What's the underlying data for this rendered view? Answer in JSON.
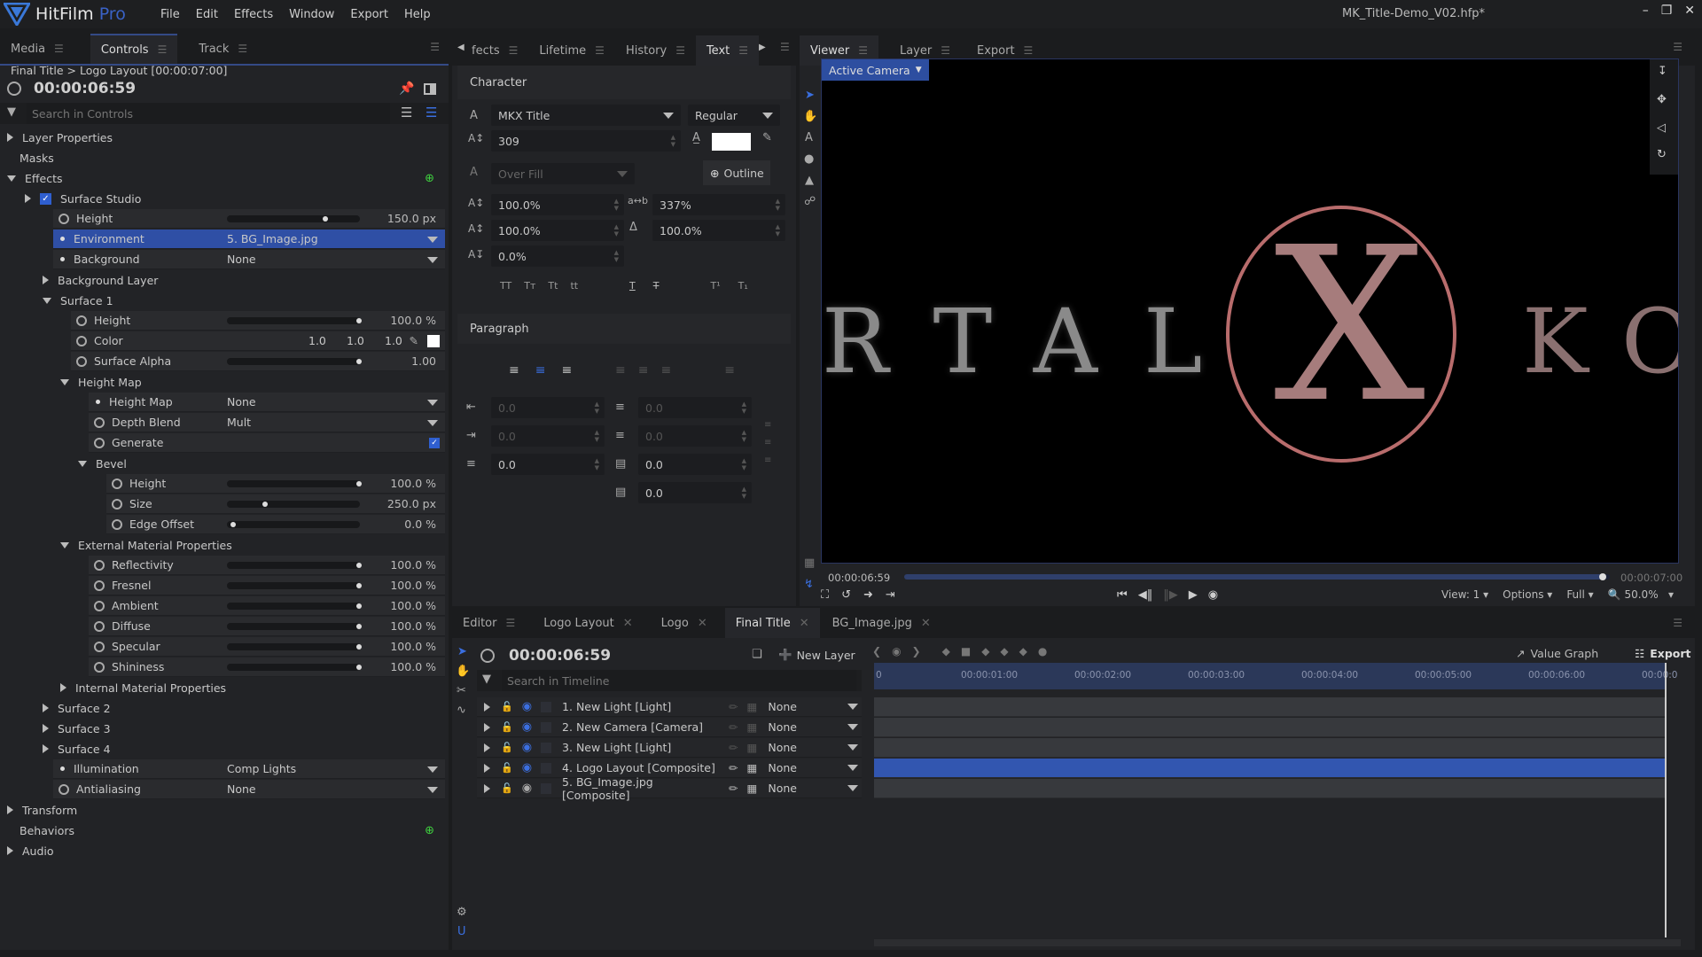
{
  "app": {
    "name": "HitFilm",
    "edition": "Pro",
    "window_title": "MK_Title-Demo_V02.hfp*"
  },
  "menu": [
    "File",
    "Edit",
    "Effects",
    "Window",
    "Export",
    "Help"
  ],
  "left_panel": {
    "tabs": [
      {
        "label": "Media"
      },
      {
        "label": "Controls",
        "active": true
      },
      {
        "label": "Track"
      }
    ],
    "breadcrumb": "Final Title > Logo Layout [00:00:07:00]",
    "timecode": "00:00:06:59",
    "search_placeholder": "Search in Controls",
    "tree": [
      {
        "label": "Layer Properties",
        "type": "group",
        "expanded": false
      },
      {
        "label": "Masks",
        "type": "group-noarrow"
      },
      {
        "label": "Effects",
        "type": "group",
        "expanded": true
      },
      {
        "label": "Surface Studio",
        "type": "effect",
        "checked": true
      },
      {
        "label": "Height",
        "type": "slider",
        "value": "150.0 px",
        "fraction": 0.73
      },
      {
        "label": "Environment",
        "type": "dropdown",
        "value": "5. BG_Image.jpg",
        "selected": true
      },
      {
        "label": "Background",
        "type": "dropdown",
        "value": "None"
      },
      {
        "label": "Background Layer",
        "type": "subgroup",
        "expanded": false
      },
      {
        "label": "Surface 1",
        "type": "subgroup",
        "expanded": true
      },
      {
        "label": "Height",
        "type": "slider",
        "value": "100.0 %",
        "fraction": 1.0
      },
      {
        "label": "Color",
        "type": "color",
        "r": "1.0",
        "g": "1.0",
        "b": "1.0",
        "swatch": "#ffffff"
      },
      {
        "label": "Surface Alpha",
        "type": "slider",
        "value": "1.00",
        "fraction": 1.0
      },
      {
        "label": "Height Map",
        "type": "subgroup2",
        "expanded": true
      },
      {
        "label": "Height Map",
        "type": "dropdown",
        "value": "None"
      },
      {
        "label": "Depth Blend",
        "type": "dropdown",
        "value": "Mult"
      },
      {
        "label": "Generate",
        "type": "checkbox",
        "checked": true
      },
      {
        "label": "Bevel",
        "type": "subgroup3",
        "expanded": true
      },
      {
        "label": "Height",
        "type": "slider",
        "value": "100.0 %",
        "fraction": 1.0
      },
      {
        "label": "Size",
        "type": "slider",
        "value": "250.0 px",
        "fraction": 0.25
      },
      {
        "label": "Edge Offset",
        "type": "slider",
        "value": "0.0 %",
        "fraction": 0.0
      },
      {
        "label": "External Material Properties",
        "type": "subgroup2",
        "expanded": true
      },
      {
        "label": "Reflectivity",
        "type": "slider",
        "value": "100.0 %",
        "fraction": 1.0
      },
      {
        "label": "Fresnel",
        "type": "slider",
        "value": "100.0 %",
        "fraction": 1.0
      },
      {
        "label": "Ambient",
        "type": "slider",
        "value": "100.0 %",
        "fraction": 1.0
      },
      {
        "label": "Diffuse",
        "type": "slider",
        "value": "100.0 %",
        "fraction": 1.0
      },
      {
        "label": "Specular",
        "type": "slider",
        "value": "100.0 %",
        "fraction": 1.0
      },
      {
        "label": "Shininess",
        "type": "slider",
        "value": "100.0 %",
        "fraction": 1.0
      },
      {
        "label": "Internal Material Properties",
        "type": "subgroup2",
        "expanded": false
      },
      {
        "label": "Surface 2",
        "type": "subgroup",
        "expanded": false
      },
      {
        "label": "Surface 3",
        "type": "subgroup",
        "expanded": false
      },
      {
        "label": "Surface 4",
        "type": "subgroup",
        "expanded": false
      },
      {
        "label": "Illumination",
        "type": "dropdown",
        "value": "Comp Lights"
      },
      {
        "label": "Antialiasing",
        "type": "dropdown",
        "value": "None"
      },
      {
        "label": "Transform",
        "type": "group",
        "expanded": false
      },
      {
        "label": "Behaviors",
        "type": "group-noarrow-add"
      },
      {
        "label": "Audio",
        "type": "group",
        "expanded": false
      }
    ]
  },
  "text_panel": {
    "tabs": [
      "fects",
      "Lifetime",
      "History",
      "Text"
    ],
    "active_tab": "Text",
    "character": {
      "title": "Character",
      "font": "MKX Title",
      "style": "Regular",
      "size": "309",
      "fill_color": "#ffffff",
      "stroke_mode": "Over Fill",
      "outline_label": "Outline",
      "vertical_scale": "100.0%",
      "tracking": "337%",
      "horizontal_scale": "100.0%",
      "leading": "100.0%",
      "baseline_shift": "0.0%",
      "case_buttons": [
        "TT",
        "Tт",
        "Tt",
        "tt"
      ],
      "style_buttons": [
        "T",
        "T",
        "T¹",
        "T₁"
      ]
    },
    "paragraph": {
      "title": "Paragraph",
      "align_active": "center",
      "indent_left": "0.0",
      "indent_right": "0.0",
      "indent_first": "0.0",
      "space_before": "0.0",
      "space_after": "0.0",
      "space_3": "0.0",
      "space_4": "0.0"
    }
  },
  "viewer": {
    "tabs": [
      "Viewer",
      "Layer",
      "Export"
    ],
    "camera": "Active Camera",
    "current_time": "00:00:06:59",
    "end_time": "00:00:07:00",
    "playhead_fraction": 0.99,
    "scene_text_left": "RTAL",
    "scene_text_right": "KO",
    "view": "View: 1",
    "options": "Options",
    "quality": "Full",
    "zoom": "50.0%"
  },
  "editor": {
    "tabs": [
      {
        "label": "Editor",
        "closable": false
      },
      {
        "label": "Logo Layout",
        "closable": true
      },
      {
        "label": "Logo",
        "closable": true
      },
      {
        "label": "Final Title",
        "closable": true,
        "active": true
      },
      {
        "label": "BG_Image.jpg",
        "closable": true
      }
    ],
    "timecode": "00:00:06:59",
    "new_layer": "New Layer",
    "search_placeholder": "Search in Timeline",
    "value_graph": "Value Graph",
    "export": "Export",
    "ruler": [
      "0",
      "00:00:01:00",
      "00:00:02:00",
      "00:00:03:00",
      "00:00:04:00",
      "00:00:05:00",
      "00:00:06:00",
      "00:00:0"
    ],
    "layers": [
      {
        "name": "1. New Light [Light]",
        "blend": "None",
        "visible": true
      },
      {
        "name": "2. New Camera [Camera]",
        "blend": "None",
        "visible": true
      },
      {
        "name": "3. New Light [Light]",
        "blend": "None",
        "visible": true
      },
      {
        "name": "4. Logo Layout [Composite]",
        "blend": "None",
        "visible": true,
        "selected": true
      },
      {
        "name": "5. BG_Image.jpg [Composite]",
        "blend": "None",
        "visible": false
      }
    ]
  },
  "colors": {
    "accent": "#3a5fc8",
    "selection": "#2f4fa5",
    "add": "#3fcf3f"
  }
}
